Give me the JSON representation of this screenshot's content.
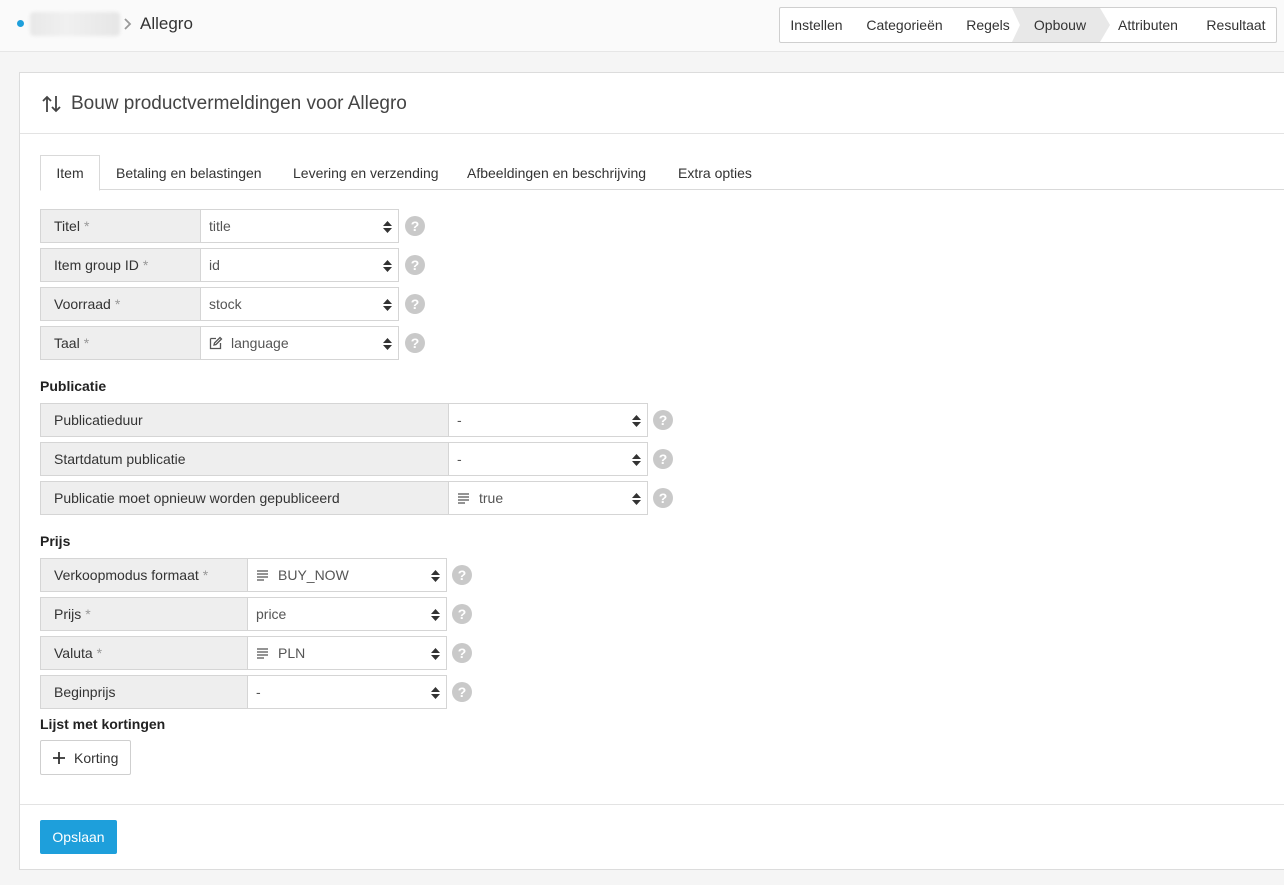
{
  "breadcrumb": {
    "current": "Allegro"
  },
  "steps": [
    "Instellen",
    "Categorieën",
    "Regels",
    "Opbouw",
    "Attributen",
    "Resultaat"
  ],
  "active_step": "Opbouw",
  "card": {
    "title": "Bouw productvermeldingen voor Allegro"
  },
  "tabs": [
    "Item",
    "Betaling en belastingen",
    "Levering en verzending",
    "Afbeeldingen en beschrijving",
    "Extra opties"
  ],
  "active_tab": "Item",
  "required_marker": "*",
  "help_glyph": "?",
  "item_fields": [
    {
      "label": "Titel",
      "value": "title",
      "icon": ""
    },
    {
      "label": "Item group ID",
      "value": "id",
      "icon": ""
    },
    {
      "label": "Voorraad",
      "value": "stock",
      "icon": ""
    },
    {
      "label": "Taal",
      "value": "language",
      "icon": "edit-icon"
    }
  ],
  "publicatie": {
    "title": "Publicatie",
    "fields": [
      {
        "label": "Publicatieduur",
        "value": "-",
        "icon": ""
      },
      {
        "label": "Startdatum publicatie",
        "value": "-",
        "icon": ""
      },
      {
        "label": "Publicatie moet opnieuw worden gepubliceerd",
        "value": "true",
        "icon": "text-lines-icon"
      }
    ]
  },
  "prijs": {
    "title": "Prijs",
    "fields": [
      {
        "label": "Verkoopmodus formaat",
        "value": "BUY_NOW",
        "icon": "text-lines-icon"
      },
      {
        "label": "Prijs",
        "value": "price",
        "icon": ""
      },
      {
        "label": "Valuta",
        "value": "PLN",
        "icon": "text-lines-icon"
      },
      {
        "label": "Beginprijs",
        "value": "-",
        "icon": ""
      }
    ]
  },
  "kortingen": {
    "title": "Lijst met kortingen",
    "add_label": "Korting"
  },
  "save_label": "Opslaan",
  "colors": {
    "accent": "#1e9fdb",
    "label_bg": "#eeeeee",
    "active_step_bg": "#e8e8e8"
  }
}
